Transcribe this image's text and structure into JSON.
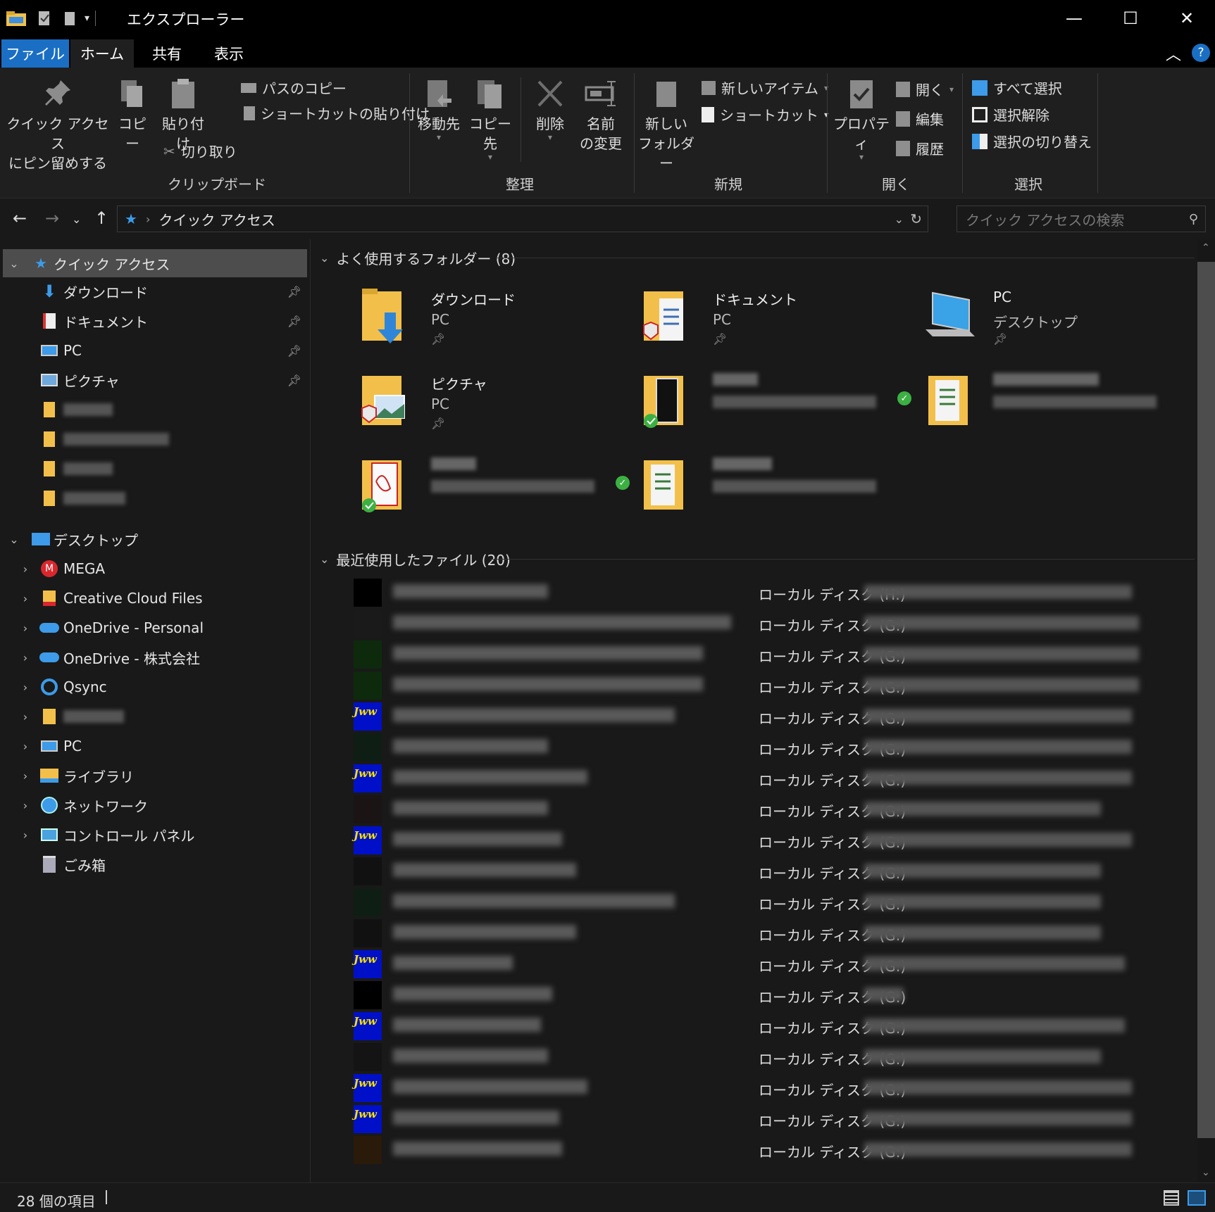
{
  "window": {
    "title": "エクスプローラー",
    "minimize": "—",
    "maximize": "☐",
    "close": "✕"
  },
  "tabs": {
    "file": "ファイル",
    "home": "ホーム",
    "share": "共有",
    "view": "表示"
  },
  "ribbon": {
    "pin_line1": "クイック アクセス",
    "pin_line2": "にピン留めする",
    "copy": "コピー",
    "paste": "貼り付け",
    "copy_path": "パスのコピー",
    "paste_shortcut": "ショートカットの貼り付け",
    "cut": "切り取り",
    "group_clipboard": "クリップボード",
    "move_to": "移動先",
    "copy_to": "コピー先",
    "delete": "削除",
    "rename_line1": "名前",
    "rename_line2": "の変更",
    "group_organize": "整理",
    "new_item": "新しいアイテム",
    "shortcut": "ショートカット",
    "new_folder_line1": "新しい",
    "new_folder_line2": "フォルダー",
    "group_new": "新規",
    "properties": "プロパティ",
    "open": "開く",
    "edit": "編集",
    "history": "履歴",
    "group_open": "開く",
    "select_all": "すべて選択",
    "select_none": "選択解除",
    "invert_selection": "選択の切り替え",
    "group_select": "選択"
  },
  "address": {
    "path": "クイック アクセス",
    "search_placeholder": "クイック アクセスの検索"
  },
  "nav": {
    "quick_access": "クイック アクセス",
    "downloads": "ダウンロード",
    "documents": "ドキュメント",
    "pc": "PC",
    "pictures": "ピクチャ",
    "desktop": "デスクトップ",
    "mega": "MEGA",
    "creative_cloud": "Creative Cloud Files",
    "onedrive_personal": "OneDrive - Personal",
    "onedrive_company": "OneDrive - 株式会社",
    "qsync": "Qsync",
    "pc2": "PC",
    "libraries": "ライブラリ",
    "network": "ネットワーク",
    "control_panel": "コントロール パネル",
    "recycle_bin": "ごみ箱"
  },
  "frequent": {
    "header": "よく使用するフォルダー (8)",
    "items": [
      {
        "name": "ダウンロード",
        "sub": "PC"
      },
      {
        "name": "ドキュメント",
        "sub": "PC"
      },
      {
        "name": "PC",
        "sub": "デスクトップ"
      },
      {
        "name": "ピクチャ",
        "sub": "PC"
      }
    ]
  },
  "recent": {
    "header": "最近使用したファイル (20)",
    "locations": [
      "ローカル ディスク (H:)",
      "ローカル ディスク (G:)",
      "ローカル ディスク (G:)",
      "ローカル ディスク (G:)",
      "ローカル ディスク (G:)",
      "ローカル ディスク (G:)",
      "ローカル ディスク (G:)",
      "ローカル ディスク (G:)",
      "ローカル ディスク (G:)",
      "ローカル ディスク (G:)",
      "ローカル ディスク (G:)",
      "ローカル ディスク (G:)",
      "ローカル ディスク (G:)",
      "ローカル ディスク (G:)",
      "ローカル ディスク (G:)",
      "ローカル ディスク (G:)",
      "ローカル ディスク (G:)",
      "ローカル ディスク (G:)",
      "ローカル ディスク (G:)"
    ]
  },
  "status": {
    "count": "28 個の項目"
  },
  "colors": {
    "accent": "#1a6fc4",
    "folder": "#f2c04a",
    "selection": "#4d4d4d",
    "sync_ok": "#3cb043"
  }
}
